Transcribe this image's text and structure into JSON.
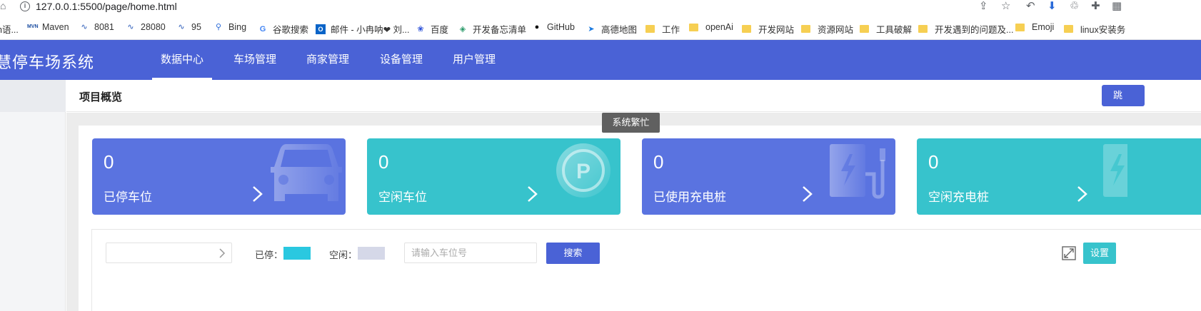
{
  "browser": {
    "url": "127.0.0.1:5500/page/home.html",
    "bookmarks": [
      {
        "label": "h语...",
        "icon": "generic-icon"
      },
      {
        "label": "Maven",
        "icon": "maven-icon"
      },
      {
        "label": "8081",
        "icon": "wave-icon"
      },
      {
        "label": "28080",
        "icon": "wave-icon"
      },
      {
        "label": "95",
        "icon": "wave-icon"
      },
      {
        "label": "Bing",
        "icon": "search-icon"
      },
      {
        "label": "谷歌搜索",
        "icon": "google-icon"
      },
      {
        "label": "邮件 - 小冉呐❤ 刘...",
        "icon": "outlook-icon"
      },
      {
        "label": "百度",
        "icon": "baidu-icon"
      },
      {
        "label": "开发备忘清单",
        "icon": "shield-icon"
      },
      {
        "label": "GitHub",
        "icon": "github-icon"
      },
      {
        "label": "高德地图",
        "icon": "map-icon"
      },
      {
        "label": "工作",
        "icon": "folder-icon"
      },
      {
        "label": "openAi",
        "icon": "folder-icon"
      },
      {
        "label": "开发网站",
        "icon": "folder-icon"
      },
      {
        "label": "资源网站",
        "icon": "folder-icon"
      },
      {
        "label": "工具破解",
        "icon": "folder-icon"
      },
      {
        "label": "开发遇到的问题及...",
        "icon": "folder-icon"
      },
      {
        "label": "Emoji",
        "icon": "folder-icon"
      },
      {
        "label": "linux安装务",
        "icon": "folder-icon"
      }
    ]
  },
  "header": {
    "brand": "慧停车场系统",
    "nav": [
      "数据中心",
      "车场管理",
      "商家管理",
      "设备管理",
      "用户管理"
    ]
  },
  "subheader": {
    "title": "项目概览",
    "button": "跳"
  },
  "tooltip": "系统繁忙",
  "cards": [
    {
      "value": "0",
      "label": "已停车位",
      "color": "#5a73e0",
      "icon": "car-icon"
    },
    {
      "value": "0",
      "label": "空闲车位",
      "color": "#37c3cc",
      "icon": "parking-icon"
    },
    {
      "value": "0",
      "label": "已使用充电桩",
      "color": "#5a73e0",
      "icon": "charger-icon"
    },
    {
      "value": "0",
      "label": "空闲充电桩",
      "color": "#37c3cc",
      "icon": "charger-icon"
    }
  ],
  "filter": {
    "select_value": "",
    "legend_parked": "已停：",
    "legend_free": "空闲：",
    "parked_color": "#2ac8e0",
    "free_color": "#d5d8e8",
    "input_placeholder": "请输入车位号",
    "search_label": "搜索",
    "settings_label": "设置"
  }
}
